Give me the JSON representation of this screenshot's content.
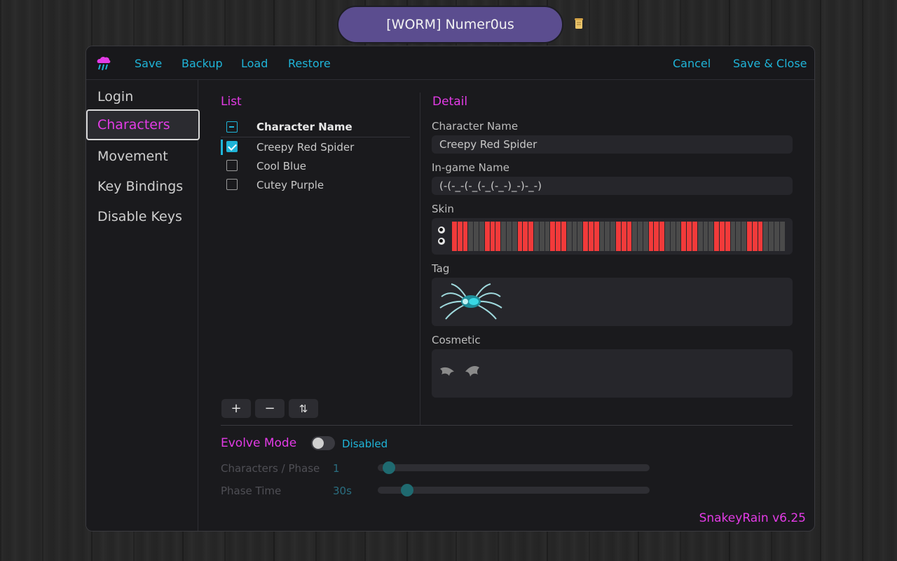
{
  "player": {
    "name": "[WORM] Numer0us",
    "icon": "scroll-icon"
  },
  "toolbar": {
    "logo_icon": "rain-cloud-logo-icon",
    "save": "Save",
    "backup": "Backup",
    "load": "Load",
    "restore": "Restore",
    "cancel": "Cancel",
    "save_close": "Save & Close"
  },
  "sidebar": {
    "items": [
      {
        "label": "Login",
        "active": false
      },
      {
        "label": "Characters",
        "active": true
      },
      {
        "label": "Movement",
        "active": false
      },
      {
        "label": "Key Bindings",
        "active": false
      },
      {
        "label": "Disable Keys",
        "active": false
      }
    ]
  },
  "list": {
    "title": "List",
    "column_header": "Character Name",
    "rows": [
      {
        "name": "Creepy Red Spider",
        "checked": true,
        "selected": true
      },
      {
        "name": "Cool Blue",
        "checked": false,
        "selected": false
      },
      {
        "name": "Cutey Purple",
        "checked": false,
        "selected": false
      }
    ],
    "buttons": {
      "add": "+",
      "remove": "−",
      "sort": "⇅"
    }
  },
  "detail": {
    "title": "Detail",
    "character_name_label": "Character Name",
    "character_name_value": "Creepy Red Spider",
    "ingame_name_label": "In-game Name",
    "ingame_name_value": "(-(-_-(-_(-_(-_-)_-)-_-)",
    "skin_label": "Skin",
    "skin_colors": {
      "red": "#f23a3a",
      "gray": "#4a4a4a"
    },
    "tag_label": "Tag",
    "tag_icon": "spider-tag-icon",
    "cosmetic_label": "Cosmetic",
    "cosmetic_icon": "bat-wings-icon"
  },
  "evolve": {
    "title": "Evolve Mode",
    "toggle_state": "Disabled",
    "enabled": false,
    "characters_per_phase_label": "Characters / Phase",
    "characters_per_phase_value": "1",
    "characters_per_phase_fraction": 0.02,
    "phase_time_label": "Phase Time",
    "phase_time_value": "30s",
    "phase_time_fraction": 0.09
  },
  "version": "SnakeyRain v6.25",
  "colors": {
    "accent_magenta": "#e33be6",
    "accent_cyan": "#1fb4d8",
    "pill": "#5b4d8f"
  }
}
